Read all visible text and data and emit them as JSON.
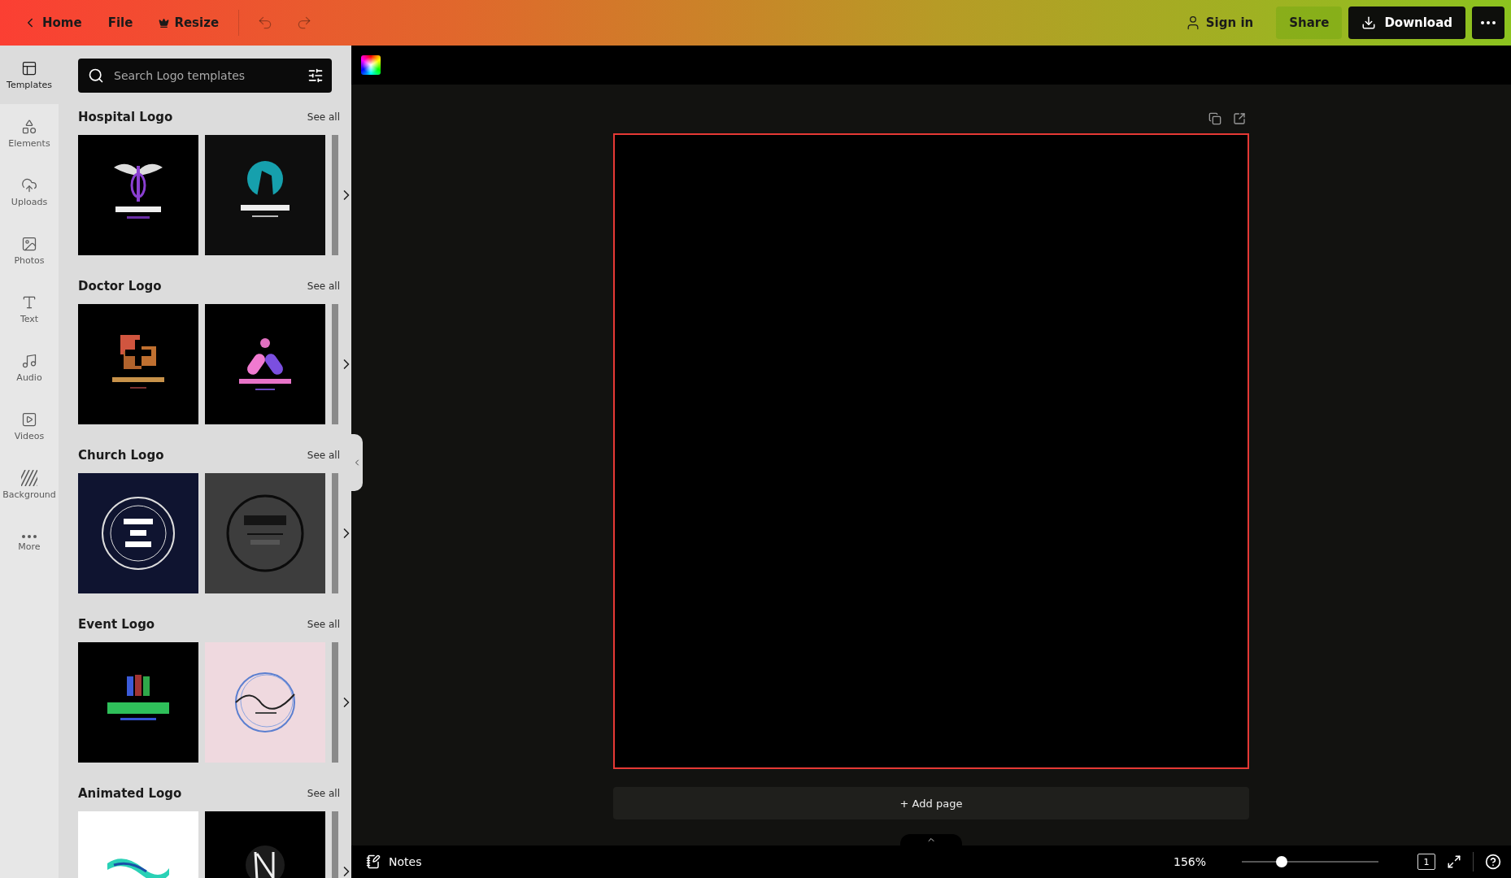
{
  "topbar": {
    "nav": [
      {
        "kind": "back",
        "label": "Home"
      },
      {
        "kind": "plain",
        "label": "File"
      },
      {
        "kind": "crown",
        "label": "Resize"
      }
    ],
    "sign_in": "Sign in",
    "share": "Share",
    "download": "Download"
  },
  "rail": [
    {
      "kind": "templates",
      "label": "Templates",
      "selected": true
    },
    {
      "kind": "elements",
      "label": "Elements",
      "selected": false
    },
    {
      "kind": "uploads",
      "label": "Uploads",
      "selected": false
    },
    {
      "kind": "photos",
      "label": "Photos",
      "selected": false
    },
    {
      "kind": "text",
      "label": "Text",
      "selected": false
    },
    {
      "kind": "audio",
      "label": "Audio",
      "selected": false
    },
    {
      "kind": "videos",
      "label": "Videos",
      "selected": false
    },
    {
      "kind": "background",
      "label": "Background",
      "selected": false
    },
    {
      "kind": "more",
      "label": "More",
      "selected": false
    }
  ],
  "search": {
    "placeholder": "Search Logo templates"
  },
  "sections": [
    {
      "title": "Hospital Logo",
      "see_all": "See all"
    },
    {
      "title": "Doctor Logo",
      "see_all": "See all"
    },
    {
      "title": "Church Logo",
      "see_all": "See all"
    },
    {
      "title": "Event Logo",
      "see_all": "See all"
    },
    {
      "title": "Animated Logo",
      "see_all": "See all"
    }
  ],
  "canvas": {
    "add_page": "+ Add page"
  },
  "footer": {
    "notes": "Notes",
    "zoom": "156%",
    "level": 0.29,
    "page_count": "1"
  }
}
